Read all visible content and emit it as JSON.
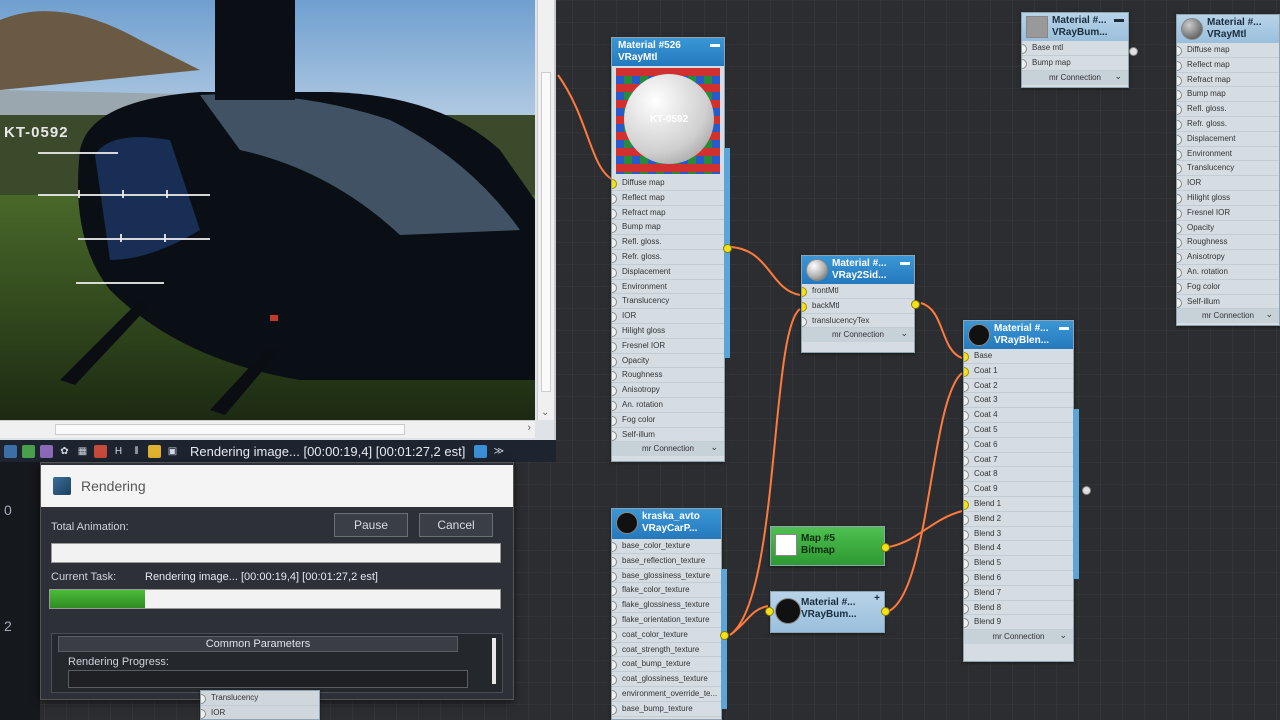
{
  "viewport": {
    "status_text": "Rendering image... [00:00:19,4] [00:01:27,2 est]",
    "overlay_text": "KT-0592"
  },
  "left_strip": {
    "label_top": "0",
    "label_bottom": "2"
  },
  "render_dialog": {
    "title": "Rendering",
    "total_animation_label": "Total Animation:",
    "pause_label": "Pause",
    "cancel_label": "Cancel",
    "current_task_label": "Current Task:",
    "current_task_value": "Rendering image... [00:00:19,4] [00:01:27,2 est]",
    "total_progress": 0.0,
    "task_progress": 0.21,
    "common_parameters_label": "Common Parameters",
    "rendering_progress_label": "Rendering Progress:"
  },
  "nodes": {
    "vray_mtl_526": {
      "title1": "Material #526",
      "title2": "VRayMtl",
      "preview_text": "KT-0592",
      "slots": [
        "Diffuse map",
        "Reflect map",
        "Refract map",
        "Bump map",
        "Refl. gloss.",
        "Refr. gloss.",
        "Displacement",
        "Environment",
        "Translucency",
        "IOR",
        "Hilight gloss",
        "Fresnel IOR",
        "Opacity",
        "Roughness",
        "Anisotropy",
        "An. rotation",
        "Fog color",
        "Self-illum"
      ],
      "connection": "mr Connection"
    },
    "vray2sided": {
      "title1": "Material #...",
      "title2": "VRay2Sid...",
      "slots": [
        "frontMtl",
        "backMtl",
        "translucencyTex"
      ],
      "connection": "mr Connection"
    },
    "vray_blend": {
      "title1": "Material #...",
      "title2": "VRayBlen...",
      "slots": [
        "Base",
        "Coat 1",
        "Coat 2",
        "Coat 3",
        "Coat 4",
        "Coat 5",
        "Coat 6",
        "Coat 7",
        "Coat 8",
        "Coat 9",
        "Blend 1",
        "Blend 2",
        "Blend 3",
        "Blend 4",
        "Blend 5",
        "Blend 6",
        "Blend 7",
        "Blend 8",
        "Blend 9"
      ],
      "connection": "mr Connection"
    },
    "bitmap": {
      "title1": "Map #5",
      "title2": "Bitmap"
    },
    "vray_bump": {
      "title1": "Material #...",
      "title2": "VRayBum..."
    },
    "kraska": {
      "title1": "kraska_avto",
      "title2": "VRayCarP...",
      "slots": [
        "base_color_texture",
        "base_reflection_texture",
        "base_glossiness_texture",
        "flake_color_texture",
        "flake_glossiness_texture",
        "flake_orientation_texture",
        "coat_color_texture",
        "coat_strength_texture",
        "coat_bump_texture",
        "coat_glossiness_texture",
        "environment_override_te...",
        "base_bump_texture"
      ]
    },
    "top_bump": {
      "title1": "Material #...",
      "title2": "VRayBum...",
      "slots": [
        "Base mtl",
        "Bump map"
      ],
      "connection": "mr Connection"
    },
    "right_vraymtl": {
      "title1": "Material #...",
      "title2": "VRayMtl",
      "slots": [
        "Diffuse map",
        "Reflect map",
        "Refract map",
        "Bump map",
        "Refl. gloss.",
        "Refr. gloss.",
        "Displacement",
        "Environment",
        "Translucency",
        "IOR",
        "Hilight gloss",
        "Fresnel IOR",
        "Opacity",
        "Roughness",
        "Anisotropy",
        "An. rotation",
        "Fog color",
        "Self-illum"
      ],
      "connection": "mr Connection"
    },
    "bottom_partial": {
      "slots": [
        "Translucency",
        "IOR"
      ]
    }
  },
  "colors": {
    "accent": "#2479bd",
    "wire": "#ff7a3d",
    "progress": "#3aa52c"
  }
}
